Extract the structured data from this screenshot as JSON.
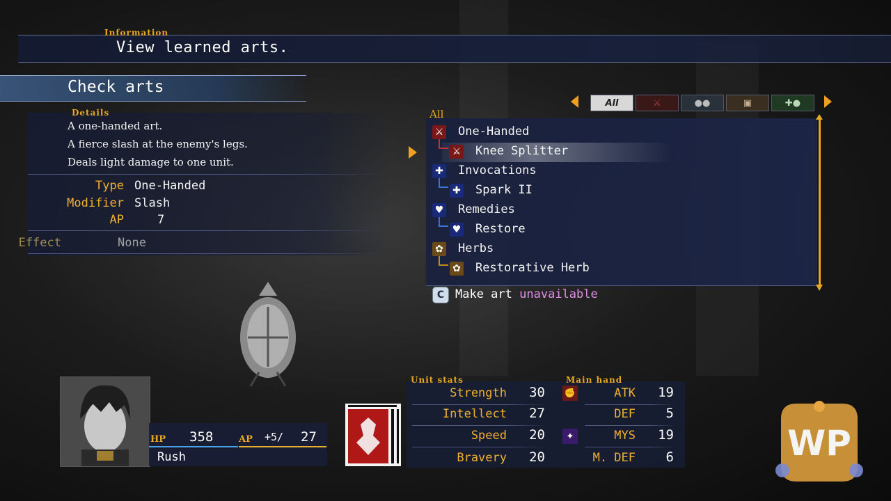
{
  "information": {
    "label": "Information",
    "text": "View learned arts."
  },
  "section": {
    "title": "Check arts"
  },
  "details": {
    "label": "Details",
    "lines": [
      "A one-handed art.",
      "A fierce slash at the enemy's legs.",
      "Deals light damage to one unit."
    ],
    "type_key": "Type",
    "type_val": "One-Handed",
    "modifier_key": "Modifier",
    "modifier_val": "Slash",
    "ap_key": "AP",
    "ap_val": "7",
    "effect_key": "Effect",
    "effect_val": "None"
  },
  "arts": {
    "filter_label": "All",
    "tabs": [
      "All",
      "",
      "",
      "",
      ""
    ],
    "items": [
      {
        "label": "One-Handed",
        "icon": "sword-icon"
      },
      {
        "label": "Knee Splitter",
        "icon": "sword-icon"
      },
      {
        "label": "Invocations",
        "icon": "lightning-icon"
      },
      {
        "label": "Spark II",
        "icon": "lightning-icon"
      },
      {
        "label": "Remedies",
        "icon": "heart-icon"
      },
      {
        "label": "Restore",
        "icon": "heart-icon"
      },
      {
        "label": "Herbs",
        "icon": "herb-icon"
      },
      {
        "label": "Restorative Herb",
        "icon": "herb-icon"
      }
    ],
    "button_key": "C",
    "make_label": "Make art",
    "make_state": "unavailable"
  },
  "character": {
    "hp_label": "HP",
    "hp": "358",
    "ap_label": "AP",
    "ap_bonus": "+5/",
    "ap": "27",
    "name": "Rush"
  },
  "unit_stats": {
    "label": "Unit stats",
    "rows": [
      {
        "key": "Strength",
        "val": "30"
      },
      {
        "key": "Intellect",
        "val": "27"
      },
      {
        "key": "Speed",
        "val": "20"
      },
      {
        "key": "Bravery",
        "val": "20"
      }
    ]
  },
  "main_hand": {
    "label": "Main hand",
    "rows": [
      {
        "key": "ATK",
        "val": "19"
      },
      {
        "key": "DEF",
        "val": "5"
      },
      {
        "key": "MYS",
        "val": "19"
      },
      {
        "key": "M. DEF",
        "val": "6"
      }
    ]
  },
  "watermark": {
    "text": "WP"
  },
  "colors": {
    "accent": "#f0b030",
    "panel": "#18203c",
    "highlight": "#e090e8"
  }
}
